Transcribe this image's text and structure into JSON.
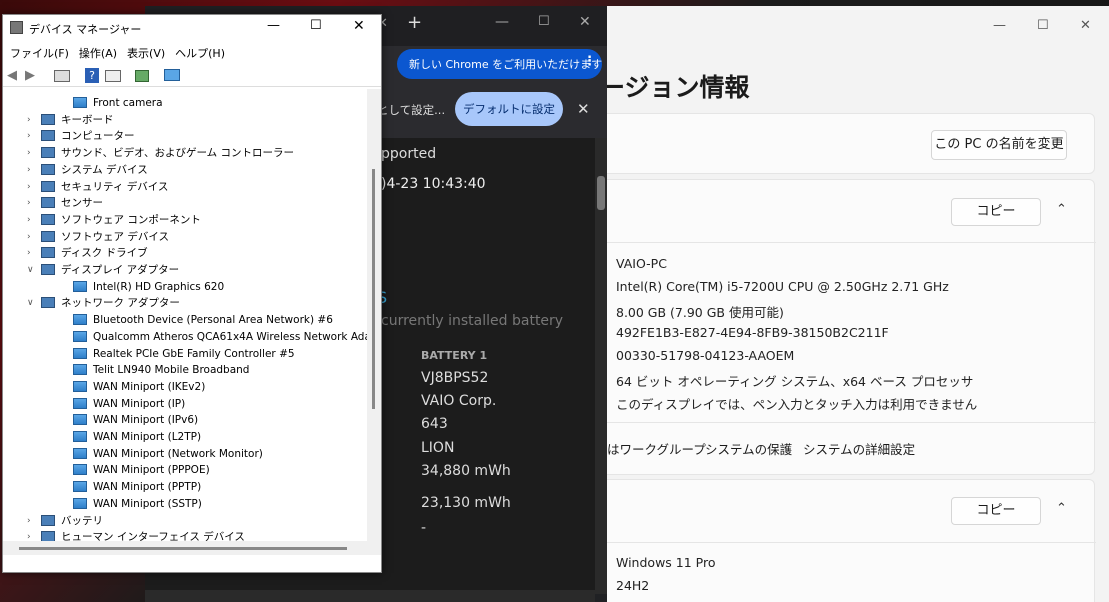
{
  "settings": {
    "title": "ージョン情報",
    "rename_btn": "この PC の名前を変更",
    "copy1": "コピー",
    "copy2": "コピー",
    "specs": [
      "VAIO-PC",
      "Intel(R) Core(TM) i5-7200U CPU @ 2.50GHz   2.71 GHz",
      "8.00 GB (7.90 GB 使用可能)",
      "492FE1B3-E827-4E94-8FB9-38150B2C211F",
      "00330-51798-04123-AAOEM",
      "64 ビット オペレーティング システム、x64 ベース プロセッサ",
      "このディスプレイでは、ペン入力とタッチ入力は利用できません"
    ],
    "links": [
      "はワークグループ",
      "システムの保護",
      "システムの詳細設定"
    ],
    "windows": [
      "Windows 11 Pro",
      "24H2"
    ]
  },
  "chrome": {
    "new_tab": "+",
    "update_btn": "新しい Chrome をご利用いただけます",
    "infobar_text": "として設定...",
    "default_btn": "デフォルトに設定",
    "supported": "pported",
    "date": ")4-23  10:43:40",
    "s": "S",
    "installed": "currently installed battery",
    "battery_header": "BATTERY 1",
    "battery_values": [
      "VJ8BPS52",
      "VAIO Corp.",
      "643",
      "LION",
      "34,880 mWh"
    ],
    "full_charge": "23,130 mWh",
    "dash": "-"
  },
  "dm": {
    "title": "デバイス マネージャー",
    "menu": [
      "ファイル(F)",
      "操作(A)",
      "表示(V)",
      "ヘルプ(H)"
    ],
    "tree": [
      {
        "label": "Front camera",
        "level": 2,
        "exp": ""
      },
      {
        "label": "キーボード",
        "level": 1,
        "exp": ">"
      },
      {
        "label": "コンピューター",
        "level": 1,
        "exp": ">"
      },
      {
        "label": "サウンド、ビデオ、およびゲーム コントローラー",
        "level": 1,
        "exp": ">"
      },
      {
        "label": "システム デバイス",
        "level": 1,
        "exp": ">"
      },
      {
        "label": "セキュリティ デバイス",
        "level": 1,
        "exp": ">"
      },
      {
        "label": "センサー",
        "level": 1,
        "exp": ">"
      },
      {
        "label": "ソフトウェア コンポーネント",
        "level": 1,
        "exp": ">"
      },
      {
        "label": "ソフトウェア デバイス",
        "level": 1,
        "exp": ">"
      },
      {
        "label": "ディスク ドライブ",
        "level": 1,
        "exp": ">"
      },
      {
        "label": "ディスプレイ アダプター",
        "level": 1,
        "exp": "v"
      },
      {
        "label": "Intel(R) HD Graphics 620",
        "level": 2,
        "exp": ""
      },
      {
        "label": "ネットワーク アダプター",
        "level": 1,
        "exp": "v"
      },
      {
        "label": "Bluetooth Device (Personal Area Network) #6",
        "level": 2,
        "exp": ""
      },
      {
        "label": "Qualcomm Atheros QCA61x4A Wireless Network Adapter #2",
        "level": 2,
        "exp": ""
      },
      {
        "label": "Realtek PCIe GbE Family Controller #5",
        "level": 2,
        "exp": ""
      },
      {
        "label": "Telit LN940 Mobile Broadband",
        "level": 2,
        "exp": ""
      },
      {
        "label": "WAN Miniport (IKEv2)",
        "level": 2,
        "exp": ""
      },
      {
        "label": "WAN Miniport (IP)",
        "level": 2,
        "exp": ""
      },
      {
        "label": "WAN Miniport (IPv6)",
        "level": 2,
        "exp": ""
      },
      {
        "label": "WAN Miniport (L2TP)",
        "level": 2,
        "exp": ""
      },
      {
        "label": "WAN Miniport (Network Monitor)",
        "level": 2,
        "exp": ""
      },
      {
        "label": "WAN Miniport (PPPOE)",
        "level": 2,
        "exp": ""
      },
      {
        "label": "WAN Miniport (PPTP)",
        "level": 2,
        "exp": ""
      },
      {
        "label": "WAN Miniport (SSTP)",
        "level": 2,
        "exp": ""
      },
      {
        "label": "バッテリ",
        "level": 1,
        "exp": ">"
      },
      {
        "label": "ヒューマン インターフェイス デバイス",
        "level": 1,
        "exp": ">"
      }
    ]
  },
  "colors": {
    "chrome_pill": "#0b57d0",
    "chrome_default_btn": "#a8c7fa",
    "settings_bg": "#f3f3f3"
  }
}
